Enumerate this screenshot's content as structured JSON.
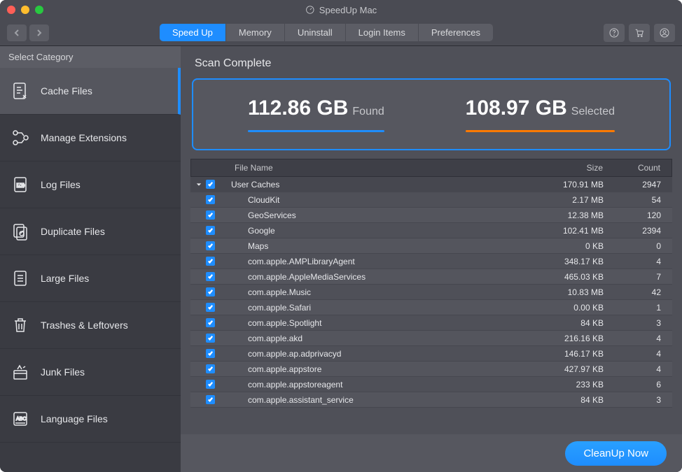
{
  "app_title": "SpeedUp Mac",
  "tabs": [
    "Speed Up",
    "Memory",
    "Uninstall",
    "Login Items",
    "Preferences"
  ],
  "active_tab": 0,
  "sidebar": {
    "header": "Select Category",
    "items": [
      {
        "label": "Cache Files",
        "icon": "cache-files-icon"
      },
      {
        "label": "Manage Extensions",
        "icon": "extensions-icon"
      },
      {
        "label": "Log Files",
        "icon": "log-files-icon"
      },
      {
        "label": "Duplicate Files",
        "icon": "duplicate-files-icon"
      },
      {
        "label": "Large Files",
        "icon": "large-files-icon"
      },
      {
        "label": "Trashes & Leftovers",
        "icon": "trash-icon"
      },
      {
        "label": "Junk Files",
        "icon": "junk-files-icon"
      },
      {
        "label": "Language Files",
        "icon": "language-files-icon"
      }
    ],
    "active_index": 0
  },
  "main": {
    "scan_label": "Scan Complete",
    "found_value": "112.86 GB",
    "found_label": "Found",
    "selected_value": "108.97 GB",
    "selected_label": "Selected",
    "columns": {
      "name": "File Name",
      "size": "Size",
      "count": "Count"
    },
    "rows": [
      {
        "name": "User Caches",
        "size": "170.91 MB",
        "count": "2947",
        "header": true
      },
      {
        "name": "CloudKit",
        "size": "2.17 MB",
        "count": "54"
      },
      {
        "name": "GeoServices",
        "size": "12.38 MB",
        "count": "120"
      },
      {
        "name": "Google",
        "size": "102.41 MB",
        "count": "2394"
      },
      {
        "name": "Maps",
        "size": "0  KB",
        "count": "0"
      },
      {
        "name": "com.apple.AMPLibraryAgent",
        "size": "348.17 KB",
        "count": "4"
      },
      {
        "name": "com.apple.AppleMediaServices",
        "size": "465.03 KB",
        "count": "7"
      },
      {
        "name": "com.apple.Music",
        "size": "10.83 MB",
        "count": "42"
      },
      {
        "name": "com.apple.Safari",
        "size": "0.00 KB",
        "count": "1"
      },
      {
        "name": "com.apple.Spotlight",
        "size": "84  KB",
        "count": "3"
      },
      {
        "name": "com.apple.akd",
        "size": "216.16 KB",
        "count": "4"
      },
      {
        "name": "com.apple.ap.adprivacyd",
        "size": "146.17 KB",
        "count": "4"
      },
      {
        "name": "com.apple.appstore",
        "size": "427.97 KB",
        "count": "4"
      },
      {
        "name": "com.apple.appstoreagent",
        "size": "233  KB",
        "count": "6"
      },
      {
        "name": "com.apple.assistant_service",
        "size": "84  KB",
        "count": "3"
      }
    ]
  },
  "footer": {
    "cleanup_label": "CleanUp Now"
  }
}
